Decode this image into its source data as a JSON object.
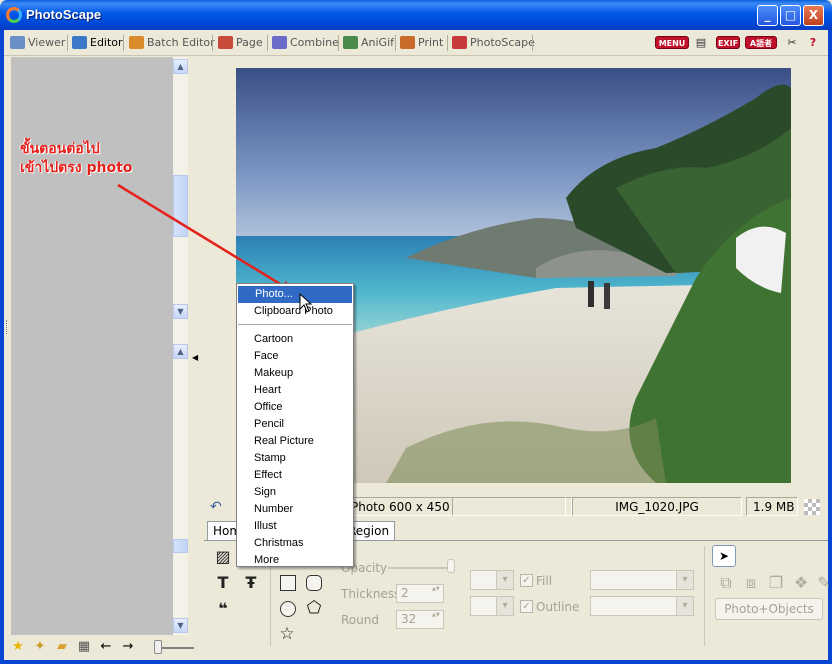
{
  "window": {
    "title": "PhotoScape",
    "controls": [
      "_",
      "□",
      "X"
    ]
  },
  "tabs": [
    {
      "label": "Viewer",
      "icon": "viewer-icon",
      "color": "#6a8fc8"
    },
    {
      "label": "Editor",
      "icon": "editor-icon",
      "color": "#3c78c8"
    },
    {
      "label": "Batch Editor",
      "icon": "batch-editor-icon",
      "color": "#d98a2a"
    },
    {
      "label": "Page",
      "icon": "page-icon",
      "color": "#c84a3a"
    },
    {
      "label": "Combine",
      "icon": "combine-icon",
      "color": "#6a6ac8"
    },
    {
      "label": "AniGif",
      "icon": "anigif-icon",
      "color": "#4a8a4a"
    },
    {
      "label": "Print",
      "icon": "print-icon",
      "color": "#c86a2a"
    },
    {
      "label": "PhotoScape",
      "icon": "photoscape-icon",
      "color": "#c83a3a"
    }
  ],
  "toolbar_right": {
    "menu_label": "MENU",
    "exif_label": "EXIF",
    "lang_label": "A語者"
  },
  "annotation": {
    "line1": "ขั้นตอนต่อไป",
    "line2": "เข้าไปตรง photo"
  },
  "context_menu": {
    "items_top": [
      "Photo...",
      "Clipboard Photo"
    ],
    "items": [
      "Cartoon",
      "Face",
      "Makeup",
      "Heart",
      "Office",
      "Pencil",
      "Real Picture",
      "Stamp",
      "Effect",
      "Sign",
      "Number",
      "Illust",
      "Christmas",
      "More"
    ],
    "highlighted": "Photo..."
  },
  "status": {
    "photo_size": "Photo 600 x 450",
    "filename": "IMG_1020.JPG",
    "filesize": "1.9 MB"
  },
  "bottom_tabs": [
    "Home",
    "Region"
  ],
  "object_panel": {
    "opacity_label": "Opacity",
    "thickness_label": "Thickness",
    "thickness_value": "2",
    "round_label": "Round",
    "round_value": "32",
    "fill_label": "Fill",
    "outline_label": "Outline",
    "photo_objects_button": "Photo+Objects"
  },
  "colors": {
    "titlebar": "#0058e6",
    "menu_highlight": "#316ac5",
    "annotation": "#e6201b",
    "left_panel": "#c0c0c0"
  }
}
